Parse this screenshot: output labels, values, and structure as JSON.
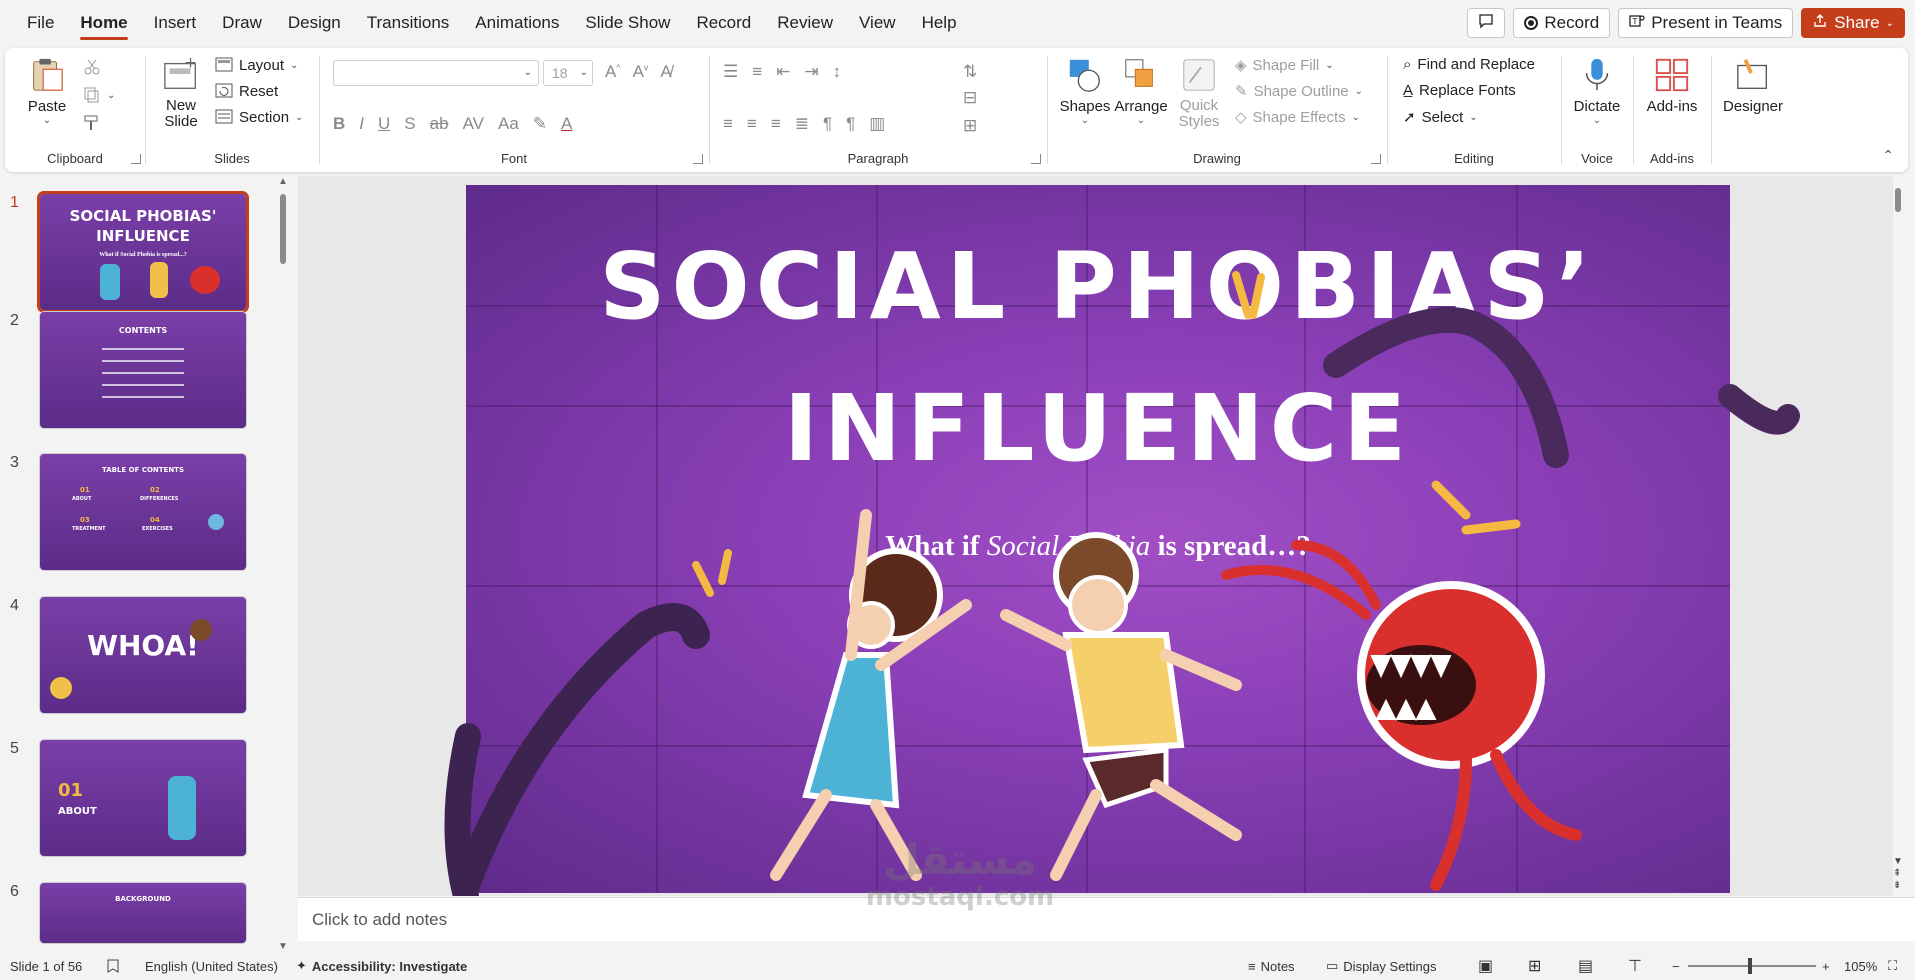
{
  "menu": {
    "items": [
      "File",
      "Home",
      "Insert",
      "Draw",
      "Design",
      "Transitions",
      "Animations",
      "Slide Show",
      "Record",
      "Review",
      "View",
      "Help"
    ],
    "active": "Home",
    "record_label": "Record",
    "present_label": "Present in Teams",
    "share_label": "Share"
  },
  "ribbon": {
    "clipboard": {
      "paste": "Paste",
      "label": "Clipboard"
    },
    "slides": {
      "new_slide": "New Slide",
      "layout": "Layout",
      "reset": "Reset",
      "section": "Section",
      "label": "Slides"
    },
    "font": {
      "size": "18",
      "label": "Font"
    },
    "paragraph": {
      "label": "Paragraph"
    },
    "drawing": {
      "shapes": "Shapes",
      "arrange": "Arrange",
      "quick_styles": "Quick Styles",
      "shape_fill": "Shape Fill",
      "shape_outline": "Shape Outline",
      "shape_effects": "Shape Effects",
      "label": "Drawing"
    },
    "editing": {
      "find_replace": "Find and Replace",
      "replace_fonts": "Replace Fonts",
      "select": "Select",
      "label": "Editing"
    },
    "voice": {
      "dictate": "Dictate",
      "label": "Voice"
    },
    "addins": {
      "addins": "Add-ins",
      "label": "Add-ins"
    },
    "designer": {
      "label": "Designer"
    }
  },
  "thumbnails": [
    {
      "num": "1",
      "title": "SOCIAL PHOBIAS' INFLUENCE",
      "subtitle": "What if Social Phobia is spread...?"
    },
    {
      "num": "2",
      "title": "CONTENTS"
    },
    {
      "num": "3",
      "title": "TABLE OF CONTENTS",
      "items": [
        "01",
        "02",
        "03",
        "04"
      ],
      "labels": [
        "ABOUT",
        "DIFFERENCES",
        "TREATMENT",
        "EXERCISES"
      ]
    },
    {
      "num": "4",
      "title": "WHOA!"
    },
    {
      "num": "5",
      "title": "01",
      "subtitle": "ABOUT"
    },
    {
      "num": "6",
      "title": "BACKGROUND"
    }
  ],
  "slide": {
    "title_line1": "SOCIAL PHOBIAS’",
    "title_line2": "INFLUENCE",
    "subtitle_prefix": "What if ",
    "subtitle_em": "Social Phobia",
    "subtitle_suffix": " is spread…?"
  },
  "notes": {
    "placeholder": "Click to add notes"
  },
  "watermark": {
    "line1": "مستقل",
    "line2": "mostaql.com"
  },
  "status": {
    "slide_info": "Slide 1 of 56",
    "language": "English (United States)",
    "accessibility": "Accessibility: Investigate",
    "notes": "Notes",
    "display_settings": "Display Settings",
    "zoom": "105%"
  },
  "colors": {
    "accent": "#c43e1c",
    "slide_bg": "#8a3fb6"
  }
}
